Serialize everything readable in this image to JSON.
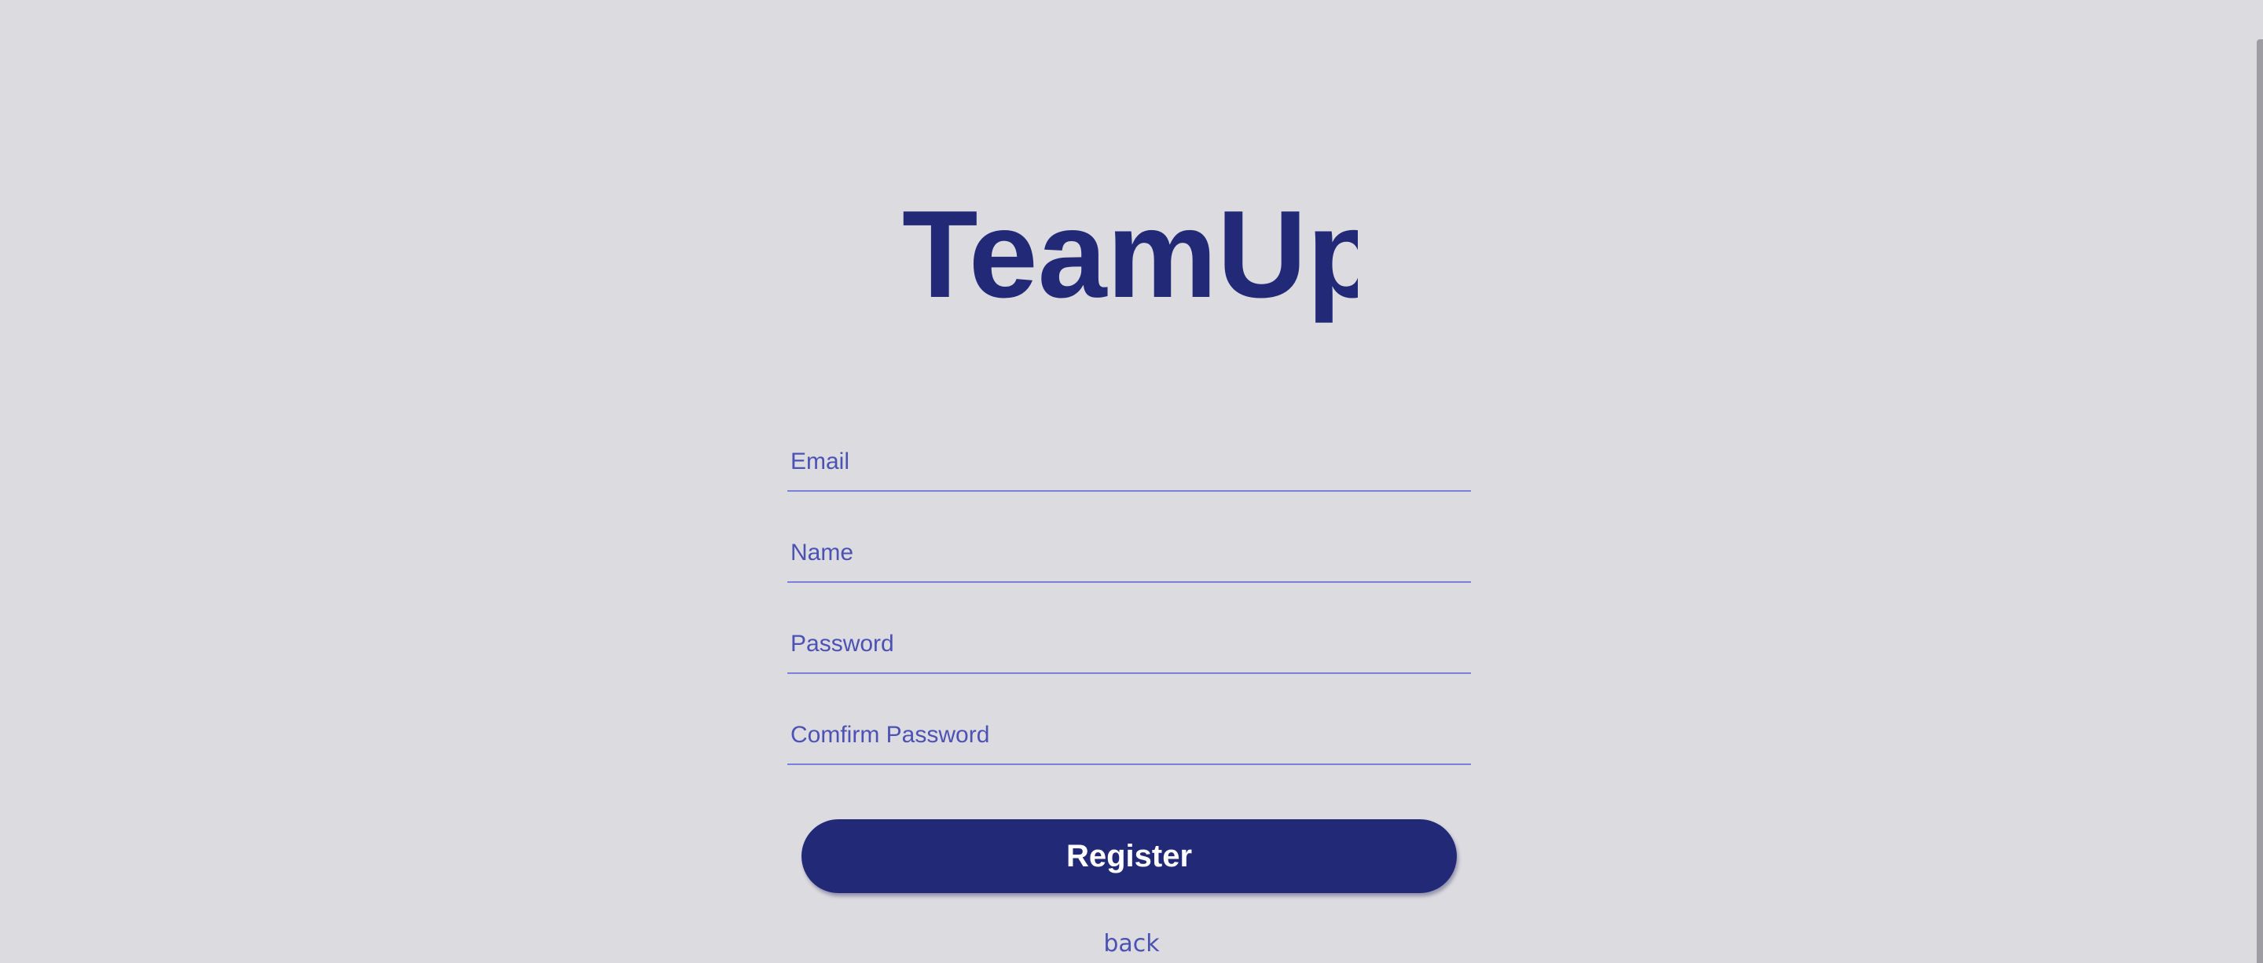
{
  "logo": {
    "text": "TeamUp",
    "color": "#222a78"
  },
  "form": {
    "email_placeholder": "Email",
    "name_placeholder": "Name",
    "password_placeholder": "Password",
    "confirm_password_placeholder": "Comfirm Password"
  },
  "actions": {
    "register_label": "Register",
    "back_label": "back"
  },
  "colors": {
    "background": "#dcdbe0",
    "brand": "#222a78",
    "field_text": "#4b52b4",
    "field_underline": "#7c80d8"
  }
}
